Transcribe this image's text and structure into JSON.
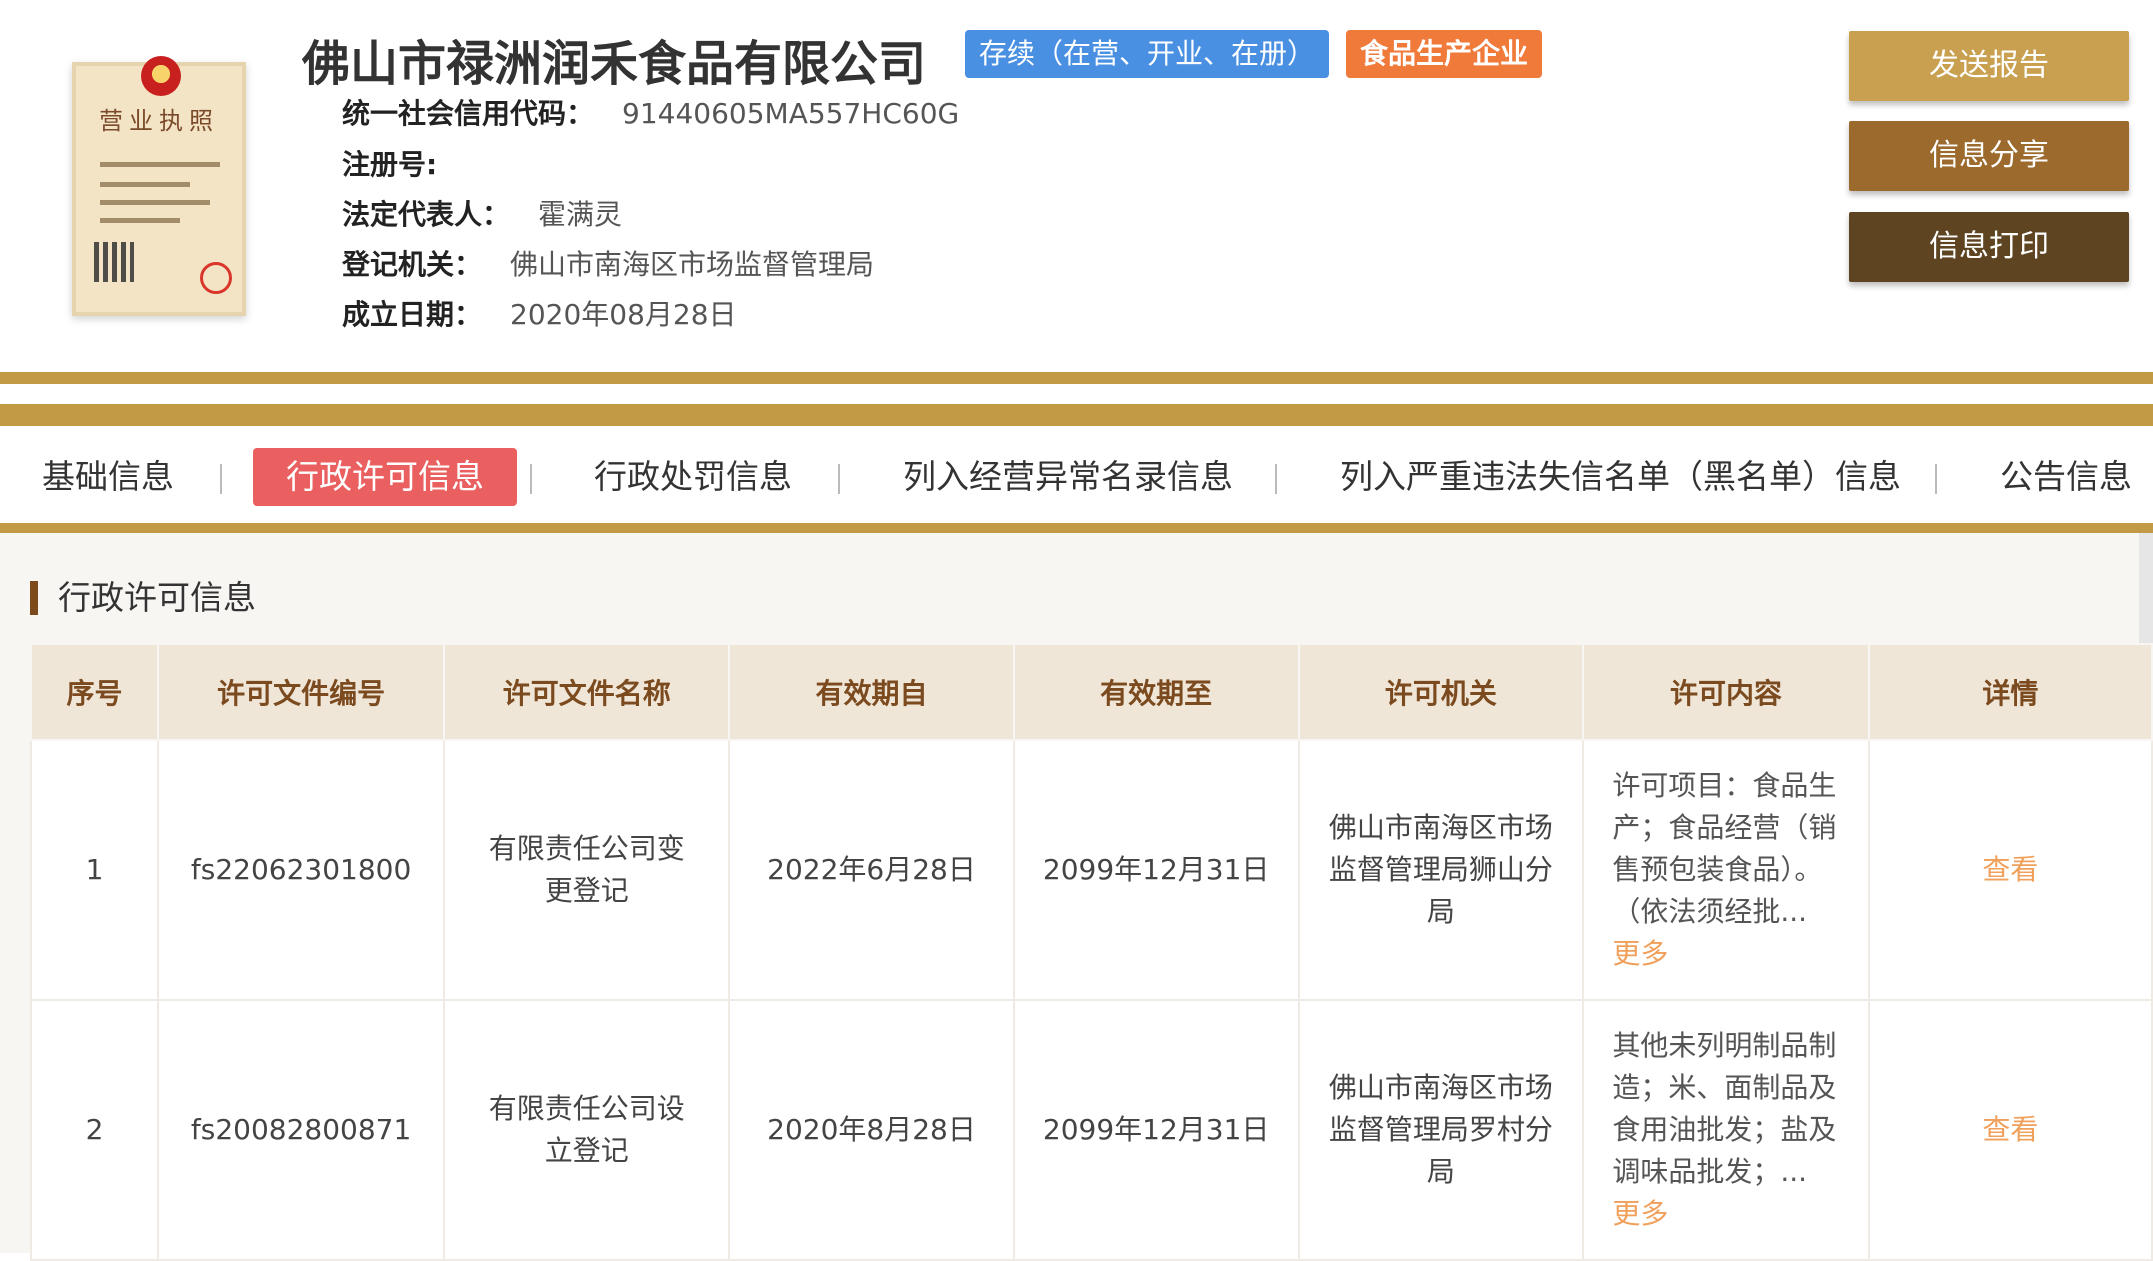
{
  "company": {
    "name": "佛山市禄洲润禾食品有限公司",
    "status_badge": "存续（在营、开业、在册）",
    "type_badge": "食品生产企业",
    "license_image_title": "营业执照",
    "fields": [
      {
        "label": "统一社会信用代码：",
        "value": "91440605MA557HC60G"
      },
      {
        "label": "注册号:",
        "value": ""
      },
      {
        "label": "法定代表人：",
        "value": "霍满灵"
      },
      {
        "label": "登记机关：",
        "value": "佛山市南海区市场监督管理局"
      },
      {
        "label": "成立日期：",
        "value": "2020年08月28日"
      }
    ]
  },
  "buttons": {
    "send_report": "发送报告",
    "share": "信息分享",
    "print": "信息打印"
  },
  "tabs": [
    {
      "label": "基础信息",
      "active": false
    },
    {
      "label": "行政许可信息",
      "active": true
    },
    {
      "label": "行政处罚信息",
      "active": false
    },
    {
      "label": "列入经营异常名录信息",
      "active": false
    },
    {
      "label": "列入严重违法失信名单（黑名单）信息",
      "active": false
    },
    {
      "label": "公告信息",
      "active": false
    }
  ],
  "section": {
    "title": "行政许可信息",
    "columns": [
      "序号",
      "许可文件编号",
      "许可文件名称",
      "有效期自",
      "有效期至",
      "许可机关",
      "许可内容",
      "详情"
    ],
    "rows": [
      {
        "no": "1",
        "file_no": "fs22062301800",
        "file_name": "有限责任公司变更登记",
        "valid_from": "2022年6月28日",
        "valid_to": "2099年12月31日",
        "authority": "佛山市南海区市场监督管理局狮山分局",
        "content": "许可项目：食品生产；食品经营（销售预包装食品）。（依法须经批...",
        "more": "更多",
        "detail": "查看"
      },
      {
        "no": "2",
        "file_no": "fs20082800871",
        "file_name": "有限责任公司设立登记",
        "valid_from": "2020年8月28日",
        "valid_to": "2099年12月31日",
        "authority": "佛山市南海区市场监督管理局罗村分局",
        "content": "其他未列明制品制造；米、面制品及食用油批发；盐及调味品批发；...",
        "more": "更多",
        "detail": "查看"
      }
    ]
  },
  "colors": {
    "gold": "#c29a45",
    "active_tab": "#ea5f5f",
    "status_badge": "#4a90e2",
    "type_badge": "#f07a3a",
    "link": "#f0a05a"
  }
}
